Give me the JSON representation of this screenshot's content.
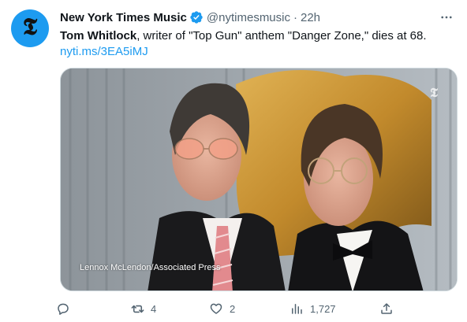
{
  "tweet": {
    "display_name": "New York Times Music",
    "handle": "@nytimesmusic",
    "separator": "·",
    "time": "22h",
    "text_lead": "Tom Whitlock",
    "text_rest": ", writer of \"Top Gun\" anthem \"Danger Zone,\" dies at 68.",
    "link": "nyti.ms/3EA5iMJ",
    "photo_credit": "Lennox McLendon/Associated Press"
  },
  "actions": {
    "reply_count": "",
    "retweet_count": "4",
    "like_count": "2",
    "views_count": "1,727"
  },
  "icons": {
    "avatar": "nyt-logo-icon",
    "verified": "verified-badge-icon",
    "more": "more-icon",
    "reply": "reply-icon",
    "retweet": "retweet-icon",
    "like": "heart-icon",
    "views": "views-icon",
    "share": "share-icon"
  },
  "colors": {
    "accent": "#1d9bf0",
    "text": "#0f1419",
    "muted": "#536471"
  }
}
